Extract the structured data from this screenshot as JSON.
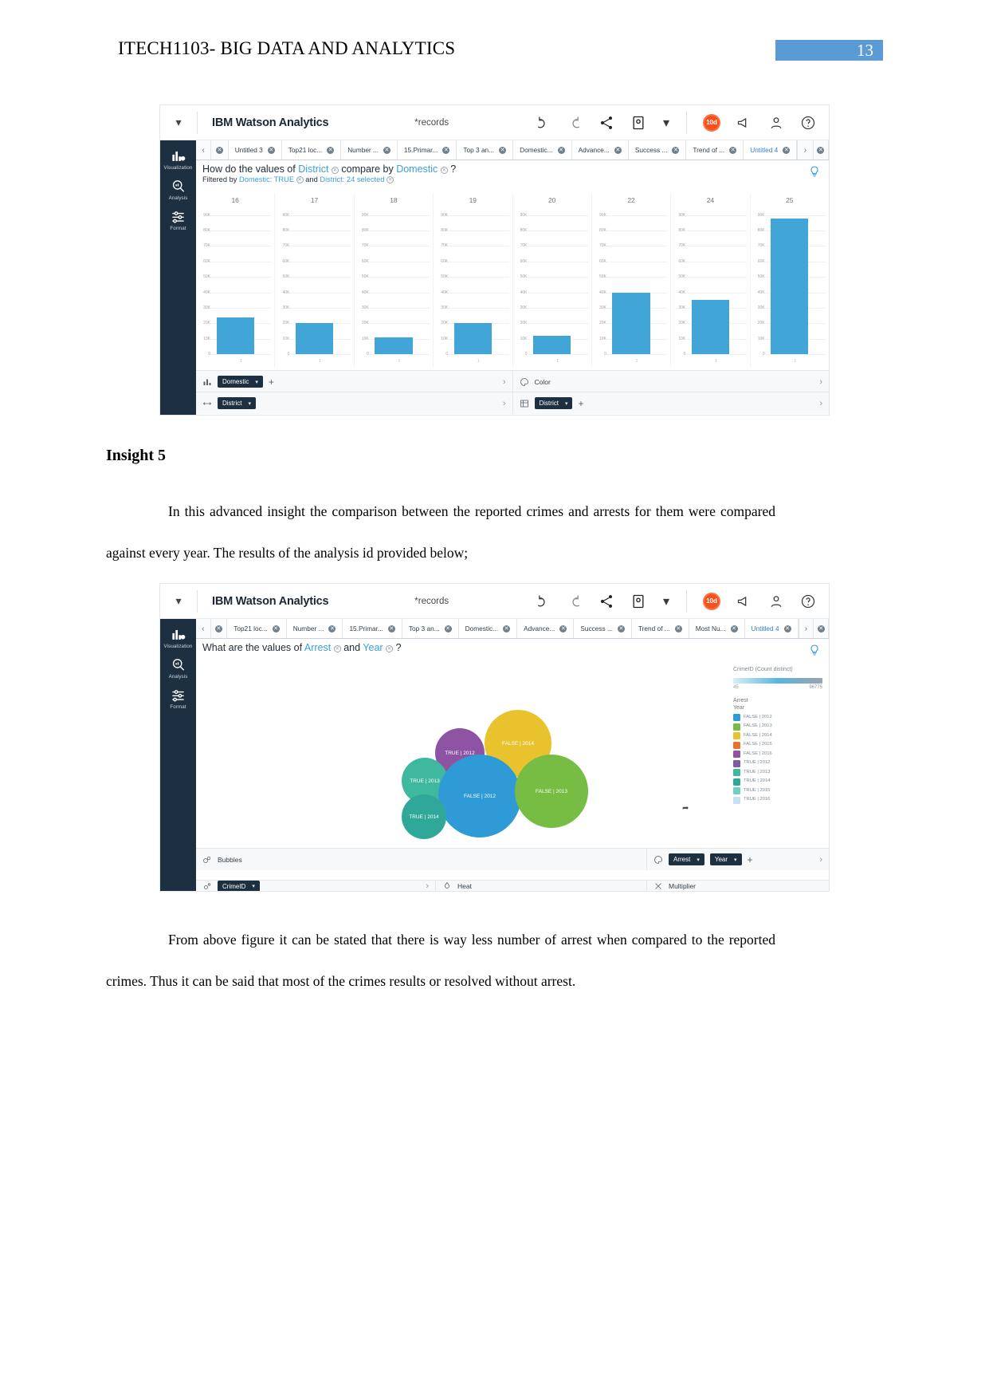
{
  "document": {
    "header_title": "ITECH1103- BIG DATA AND ANALYTICS",
    "page_number": "13",
    "insight_heading": "Insight 5",
    "paragraph_1": "In this advanced insight the   comparison between the reported crimes and arrests for them were compared against every year.  The results of the analysis id provided below;",
    "paragraph_2": "From above figure it can be stated that there is way less number of arrest when compared to the reported crimes. Thus it can be said that most of the crimes results or resolved without arrest."
  },
  "colors": {
    "header_band": "#5b9bd5",
    "bar_blue": "#42a5d8",
    "rail_navy": "#1d3042",
    "field_link": "#3ba0dd",
    "badge_orange": "#f4511e"
  },
  "screenshot_1": {
    "toolbar": {
      "caret_icon": "chevron-down-icon",
      "brand": "IBM Watson Analytics",
      "dataset": "*records",
      "undo_icon": "undo-icon",
      "redo_icon": "redo-icon",
      "share_icon": "share-icon",
      "display_icon": "display-icon",
      "display_caret_icon": "chevron-down-icon",
      "trial_badge": "10d",
      "announce_icon": "megaphone-icon",
      "account_icon": "user-icon",
      "help_icon": "help-icon"
    },
    "rail": [
      {
        "label": "Visualization",
        "icon": "bar-chart-icon"
      },
      {
        "label": "Analysis",
        "icon": "magnifier-chart-icon"
      },
      {
        "label": "Format",
        "icon": "sliders-icon"
      }
    ],
    "tabs": [
      {
        "label": "Untitled 3",
        "active": false
      },
      {
        "label": "Top21 loc...",
        "active": false
      },
      {
        "label": "Number ...",
        "active": false
      },
      {
        "label": "15.Primar...",
        "active": false
      },
      {
        "label": "Top 3 an...",
        "active": false
      },
      {
        "label": "Domestic...",
        "active": false
      },
      {
        "label": "Advance...",
        "active": false
      },
      {
        "label": "Success ...",
        "active": false
      },
      {
        "label": "Trend of ...",
        "active": false
      },
      {
        "label": "Untitled 4",
        "active": true
      }
    ],
    "question": {
      "prefix": "How do the values of",
      "field_a": "District",
      "middle": "compare by",
      "field_b": "Domestic",
      "suffix": "?",
      "filter_prefix": "Filtered by",
      "filter_a": "Domestic: TRUE",
      "filter_join": "and",
      "filter_b": "District: 24 selected",
      "insight_bulb_icon": "lightbulb-icon"
    },
    "shelves": [
      {
        "icon": "bar-chart-icon",
        "pill": "Domestic",
        "plus": "+",
        "chevron": "›"
      },
      {
        "icon": "palette-icon",
        "label": "Color",
        "chevron": "›"
      },
      {
        "icon": "arrows-icon",
        "pill": "District",
        "chevron": "›"
      },
      {
        "icon": "grid-icon",
        "pill": "District",
        "plus": "+",
        "chevron": "›"
      }
    ],
    "chart_data": {
      "type": "bar",
      "title": "How do the values of District compare by Domestic ?",
      "subtitle": "Filtered by Domestic: TRUE and District: 24 selected",
      "panel_label": "District",
      "categories": [
        "16",
        "17",
        "18",
        "19",
        "20",
        "22",
        "24",
        "25"
      ],
      "values": [
        24000,
        20000,
        11000,
        20000,
        12000,
        40000,
        35000,
        88000
      ],
      "ytick_labels": [
        "90K",
        "80K",
        "70K",
        "60K",
        "50K",
        "40K",
        "30K",
        "20K",
        "10K",
        "0"
      ],
      "ytick_values": [
        90000,
        80000,
        70000,
        60000,
        50000,
        40000,
        30000,
        20000,
        10000,
        0
      ],
      "ylim": [
        0,
        95000
      ],
      "ylabel": "",
      "xlabel": "District",
      "grid": true,
      "legend": "none",
      "series": [
        {
          "name": "Domestic: TRUE",
          "color": "#42a5d8"
        }
      ]
    }
  },
  "screenshot_2": {
    "toolbar": {
      "caret_icon": "chevron-down-icon",
      "brand": "IBM Watson Analytics",
      "dataset": "*records",
      "undo_icon": "undo-icon",
      "redo_icon": "redo-icon",
      "share_icon": "share-icon",
      "display_icon": "display-icon",
      "display_caret_icon": "chevron-down-icon",
      "trial_badge": "10d",
      "announce_icon": "megaphone-icon",
      "account_icon": "user-icon",
      "help_icon": "help-icon"
    },
    "rail": [
      {
        "label": "Visualization",
        "icon": "bar-chart-icon"
      },
      {
        "label": "Analysis",
        "icon": "magnifier-chart-icon"
      },
      {
        "label": "Format",
        "icon": "sliders-icon"
      }
    ],
    "tabs": [
      {
        "label": "Top21 loc...",
        "active": false
      },
      {
        "label": "Number ...",
        "active": false
      },
      {
        "label": "15.Primar...",
        "active": false
      },
      {
        "label": "Top 3 an...",
        "active": false
      },
      {
        "label": "Domestic...",
        "active": false
      },
      {
        "label": "Advance...",
        "active": false
      },
      {
        "label": "Success ...",
        "active": false
      },
      {
        "label": "Trend of ...",
        "active": false
      },
      {
        "label": "Most Nu...",
        "active": false
      },
      {
        "label": "Untitled 4",
        "active": true
      }
    ],
    "question": {
      "prefix": "What are the values of",
      "field_a": "Arrest",
      "middle": "and",
      "field_b": "Year",
      "suffix": "?",
      "insight_bulb_icon": "lightbulb-icon"
    },
    "legend": {
      "size_title": "CrimeID (Count distinct)",
      "size_min": "45",
      "size_max": "96775",
      "color_title_line1": "Arrest",
      "color_title_line2": "Year",
      "items": [
        {
          "label": "FALSE | 2012",
          "color": "#2e9bd6"
        },
        {
          "label": "FALSE | 2013",
          "color": "#77bc43"
        },
        {
          "label": "FALSE | 2014",
          "color": "#e8c32e"
        },
        {
          "label": "FALSE | 2015",
          "color": "#e8732e"
        },
        {
          "label": "FALSE | 2016",
          "color": "#8e54a3"
        },
        {
          "label": "TRUE | 2012",
          "color": "#7d5ba6"
        },
        {
          "label": "TRUE | 2013",
          "color": "#3fb8a0"
        },
        {
          "label": "TRUE | 2014",
          "color": "#2fa89a"
        },
        {
          "label": "TRUE | 2015",
          "color": "#6dcfc6"
        },
        {
          "label": "TRUE | 2016",
          "color": "#c9dff2"
        }
      ]
    },
    "shelves": [
      {
        "icon": "bubble-icon",
        "label": "Bubbles"
      },
      {
        "icon": "palette-icon",
        "pills": [
          "Arrest",
          "Year"
        ],
        "plus": "+",
        "chevron": "›"
      },
      {
        "icon": "size-icon",
        "pill": "CrimeID",
        "chevron": "›"
      },
      {
        "icon": "heat-icon",
        "label": "Heat"
      },
      {
        "icon": "multiplier-icon",
        "label": "Multiplier"
      }
    ],
    "chart_data": {
      "type": "scatter",
      "title": "What are the values of Arrest and Year ?",
      "size_metric": "CrimeID (Count distinct)",
      "size_range": [
        45,
        96775
      ],
      "color_by": "Arrest Year",
      "bubbles": [
        {
          "label": "FALSE | 2014",
          "color": "#e8c32e",
          "size": 88
        },
        {
          "label": "FALSE | 2012",
          "color": "#2e9bd6",
          "size": 96
        },
        {
          "label": "FALSE | 2013",
          "color": "#77bc43",
          "size": 82
        },
        {
          "label": "TRUE | 2012",
          "color": "#8e54a3",
          "size": 58
        },
        {
          "label": "TRUE | 2013",
          "color": "#3fb8a0",
          "size": 54
        },
        {
          "label": "TRUE | 2014",
          "color": "#2fa89a",
          "size": 52
        }
      ]
    }
  }
}
